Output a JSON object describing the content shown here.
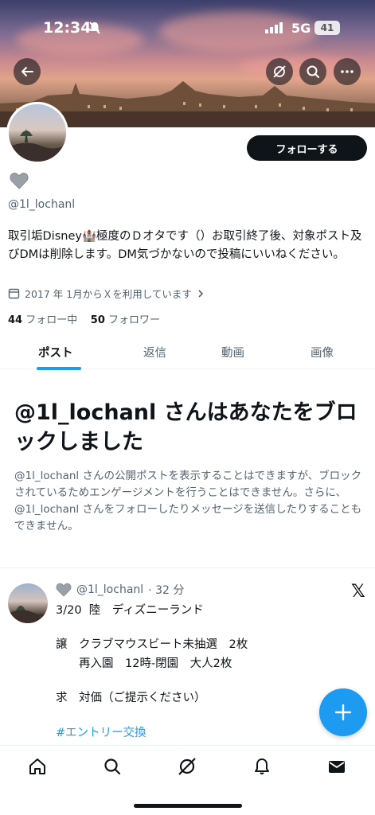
{
  "status_bar": {
    "time": "12:34",
    "network": "5G",
    "battery": "41"
  },
  "profile": {
    "follow_label": "フォローする",
    "handle": "@1l_lochanl",
    "bio": "取引垢Disney🏰極度のＤオタです（）お取引終了後、対象ポスト及びDMは削除します。DM気づかないので投稿にいいねください。",
    "joined": "2017 年 1月からＸを利用しています",
    "following_count": "44",
    "following_label": "フォロー中",
    "followers_count": "50",
    "followers_label": "フォロワー"
  },
  "tabs": [
    {
      "label": "ポスト"
    },
    {
      "label": "返信"
    },
    {
      "label": "動画"
    },
    {
      "label": "画像"
    }
  ],
  "blocked": {
    "title": "@1l_lochanl さんはあなたをブロックしました",
    "description": "@1l_lochanl さんの公開ポストを表示することはできますが、ブロックされているためエンゲージメントを行うことはできません。さらに、@1l_lochanl さんをフォローしたりメッセージを送信したりすることもできません。"
  },
  "post": {
    "handle": "@1l_lochanl",
    "time": "· 32 分",
    "lines": [
      "3/20  陸　ディズニーランド",
      "譲　クラブマウスビート未抽選　2枚",
      "　　再入園　12時-閉園　大人2枚",
      "求　対価（ご提示ください）"
    ],
    "hashtag": "#エントリー交換"
  },
  "colors": {
    "accent": "#1d9bf0",
    "text": "#0f1419",
    "muted": "#536471"
  },
  "icons": {
    "back": "arrow-left-icon",
    "grok": "grok-icon",
    "search": "search-icon",
    "more": "more-icon",
    "fab": "plus-icon"
  }
}
